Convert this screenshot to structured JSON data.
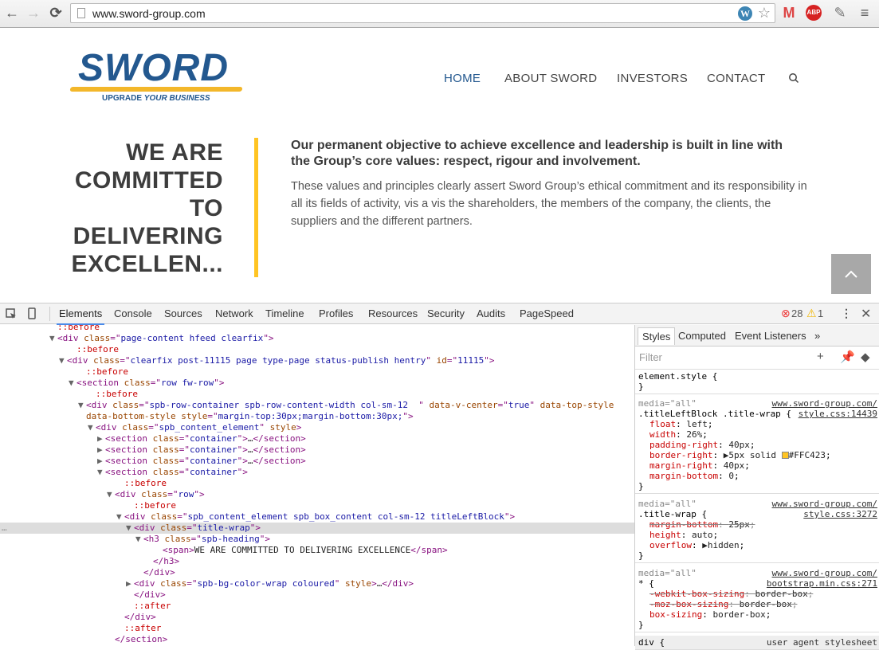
{
  "browser": {
    "url": "www.sword-group.com",
    "back_icon": "←",
    "forward_icon": "→",
    "reload_icon": "C"
  },
  "site": {
    "logo": {
      "word": "SWORD",
      "tagline_a": "UPGRADE",
      "tagline_b": "YOUR BUSINESS"
    },
    "nav": [
      {
        "label": "HOME",
        "active": true
      },
      {
        "label": "ABOUT SWORD"
      },
      {
        "label": "INVESTORS"
      },
      {
        "label": "CONTACT"
      }
    ],
    "title_lines": [
      "WE ARE",
      "COMMITTED",
      "TO",
      "DELIVERING",
      "EXCELLEN..."
    ],
    "lead": "Our permanent objective to achieve excellence and leadership is built in line with the Group’s core values: respect, rigour and involvement.",
    "body": "These values and principles clearly assert Sword Group’s ethical commitment and its responsibility in all its fields of activity, vis a vis the shareholders, the members of the company, the clients, the suppliers and the different partners.",
    "colors": {
      "brand_blue": "#23588f",
      "accent_yellow": "#FFC423"
    }
  },
  "devtools": {
    "tabs": [
      "Elements",
      "Console",
      "Sources",
      "Network",
      "Timeline",
      "Profiles",
      "Resources",
      "Security",
      "Audits",
      "PageSpeed"
    ],
    "errors": "28",
    "warnings": "1",
    "sidebar_tabs": [
      "Styles",
      "Computed",
      "Event Listeners"
    ],
    "filter_placeholder": "Filter",
    "dom": [
      {
        "indent": 6,
        "html": "<span class='ps'>::before</span>"
      },
      {
        "indent": 6,
        "arrow": "▼",
        "html": "<span class='tg'>&lt;div</span> <span class='at'>class</span><span class='tg'>=\"</span><span class='av'>page-content hfeed clearfix</span><span class='tg'>\"&gt;</span>"
      },
      {
        "indent": 8,
        "html": "<span class='ps'>::before</span>"
      },
      {
        "indent": 7,
        "arrow": "▼",
        "html": "<span class='tg'>&lt;div</span> <span class='at'>class</span><span class='tg'>=\"</span><span class='av'>clearfix post-11115 page type-page status-publish hentry</span><span class='tg'>\"</span> <span class='at'>id</span><span class='tg'>=\"</span><span class='av'>11115</span><span class='tg'>\"&gt;</span>"
      },
      {
        "indent": 9,
        "html": "<span class='ps'>::before</span>"
      },
      {
        "indent": 8,
        "arrow": "▼",
        "html": "<span class='tg'>&lt;section</span> <span class='at'>class</span><span class='tg'>=\"</span><span class='av'>row fw-row</span><span class='tg'>\"&gt;</span>"
      },
      {
        "indent": 10,
        "html": "<span class='ps'>::before</span>"
      },
      {
        "indent": 9,
        "arrow": "▼",
        "html": "<span class='tg'>&lt;div</span> <span class='at'>class</span><span class='tg'>=\"</span><span class='av'>spb-row-container spb-row-content-width col-sm-12  </span><span class='tg'>\"</span> <span class='at'>data-v-center</span><span class='tg'>=\"</span><span class='av'>true</span><span class='tg'>\"</span> <span class='at'>data-top-style</span>"
      },
      {
        "indent": 9,
        "html": "<span class='at'>data-bottom-style</span> <span class='at'>style</span><span class='tg'>=\"</span><span class='av'>margin-top:30px;margin-bottom:30px;</span><span class='tg'>\"&gt;</span>"
      },
      {
        "indent": 10,
        "arrow": "▼",
        "html": "<span class='tg'>&lt;div</span> <span class='at'>class</span><span class='tg'>=\"</span><span class='av'>spb_content_element</span><span class='tg'>\"</span> <span class='at'>style</span><span class='tg'>&gt;</span>"
      },
      {
        "indent": 11,
        "arrow": "▶",
        "html": "<span class='tg'>&lt;section</span> <span class='at'>class</span><span class='tg'>=\"</span><span class='av'>container</span><span class='tg'>\"&gt;</span><span class='tx'>…</span><span class='tg'>&lt;/section&gt;</span>"
      },
      {
        "indent": 11,
        "arrow": "▶",
        "html": "<span class='tg'>&lt;section</span> <span class='at'>class</span><span class='tg'>=\"</span><span class='av'>container</span><span class='tg'>\"&gt;</span><span class='tx'>…</span><span class='tg'>&lt;/section&gt;</span>"
      },
      {
        "indent": 11,
        "arrow": "▶",
        "html": "<span class='tg'>&lt;section</span> <span class='at'>class</span><span class='tg'>=\"</span><span class='av'>container</span><span class='tg'>\"&gt;</span><span class='tx'>…</span><span class='tg'>&lt;/section&gt;</span>"
      },
      {
        "indent": 11,
        "arrow": "▼",
        "html": "<span class='tg'>&lt;section</span> <span class='at'>class</span><span class='tg'>=\"</span><span class='av'>container</span><span class='tg'>\"&gt;</span>"
      },
      {
        "indent": 13,
        "html": "<span class='ps'>::before</span>"
      },
      {
        "indent": 12,
        "arrow": "▼",
        "html": "<span class='tg'>&lt;div</span> <span class='at'>class</span><span class='tg'>=\"</span><span class='av'>row</span><span class='tg'>\"&gt;</span>"
      },
      {
        "indent": 14,
        "html": "<span class='ps'>::before</span>"
      },
      {
        "indent": 13,
        "arrow": "▼",
        "html": "<span class='tg'>&lt;div</span> <span class='at'>class</span><span class='tg'>=\"</span><span class='av'>spb_content_element spb_box_content col-sm-12 titleLeftBlock</span><span class='tg'>\"&gt;</span>"
      },
      {
        "indent": 14,
        "arrow": "▼",
        "sel": true,
        "html": "<span class='tg'>&lt;div</span> <span class='at'>class</span><span class='tg'>=\"</span><span class='av'>title-wrap</span><span class='tg'>\"&gt;</span>"
      },
      {
        "indent": 15,
        "arrow": "▼",
        "html": "<span class='tg'>&lt;h3</span> <span class='at'>class</span><span class='tg'>=\"</span><span class='av'>spb-heading</span><span class='tg'>\"&gt;</span>"
      },
      {
        "indent": 17,
        "html": "<span class='tg'>&lt;span&gt;</span><span class='tx'>WE ARE COMMITTED TO DELIVERING EXCELLENCE</span><span class='tg'>&lt;/span&gt;</span>"
      },
      {
        "indent": 16,
        "html": "<span class='tg'>&lt;/h3&gt;</span>"
      },
      {
        "indent": 15,
        "html": "<span class='tg'>&lt;/div&gt;</span>"
      },
      {
        "indent": 14,
        "arrow": "▶",
        "html": "<span class='tg'>&lt;div</span> <span class='at'>class</span><span class='tg'>=\"</span><span class='av'>spb-bg-color-wrap coloured</span><span class='tg'>\"</span> <span class='at'>style</span><span class='tg'>&gt;</span><span class='tx'>…</span><span class='tg'>&lt;/div&gt;</span>"
      },
      {
        "indent": 14,
        "html": "<span class='tg'>&lt;/div&gt;</span>"
      },
      {
        "indent": 14,
        "html": "<span class='ps'>::after</span>"
      },
      {
        "indent": 13,
        "html": "<span class='tg'>&lt;/div&gt;</span>"
      },
      {
        "indent": 13,
        "html": "<span class='ps'>::after</span>"
      },
      {
        "indent": 12,
        "html": "<span class='tg'>&lt;/section&gt;</span>"
      }
    ],
    "styles": {
      "element_style": "element.style {",
      "rule1": {
        "media": "media=\"all\"",
        "selector": ".titleLeftBlock .title-wrap {",
        "src1": "www.sword-group.com/",
        "src2": "style.css:14439",
        "props": [
          [
            "float",
            "left"
          ],
          [
            "width",
            "26%"
          ],
          [
            "padding-right",
            "40px"
          ],
          [
            "border-right",
            "5px solid #FFC423"
          ],
          [
            "margin-right",
            "40px"
          ],
          [
            "margin-bottom",
            "0"
          ]
        ]
      },
      "rule2": {
        "media": "media=\"all\"",
        "selector": ".title-wrap {",
        "src1": "www.sword-group.com/",
        "src2": "style.css:3272",
        "props": [
          [
            "margin-bottom",
            "25px",
            true
          ],
          [
            "height",
            "auto"
          ],
          [
            "overflow",
            "hidden"
          ]
        ]
      },
      "rule3": {
        "media": "media=\"all\"",
        "selector": "* {",
        "src1": "www.sword-group.com/",
        "src2": "bootstrap.min.css:271",
        "props": [
          [
            "-webkit-box-sizing",
            "border-box",
            true
          ],
          [
            "-moz-box-sizing",
            "border-box",
            true
          ],
          [
            "box-sizing",
            "border-box"
          ]
        ]
      },
      "ua": {
        "selector": "div {",
        "src": "user agent stylesheet"
      }
    }
  }
}
